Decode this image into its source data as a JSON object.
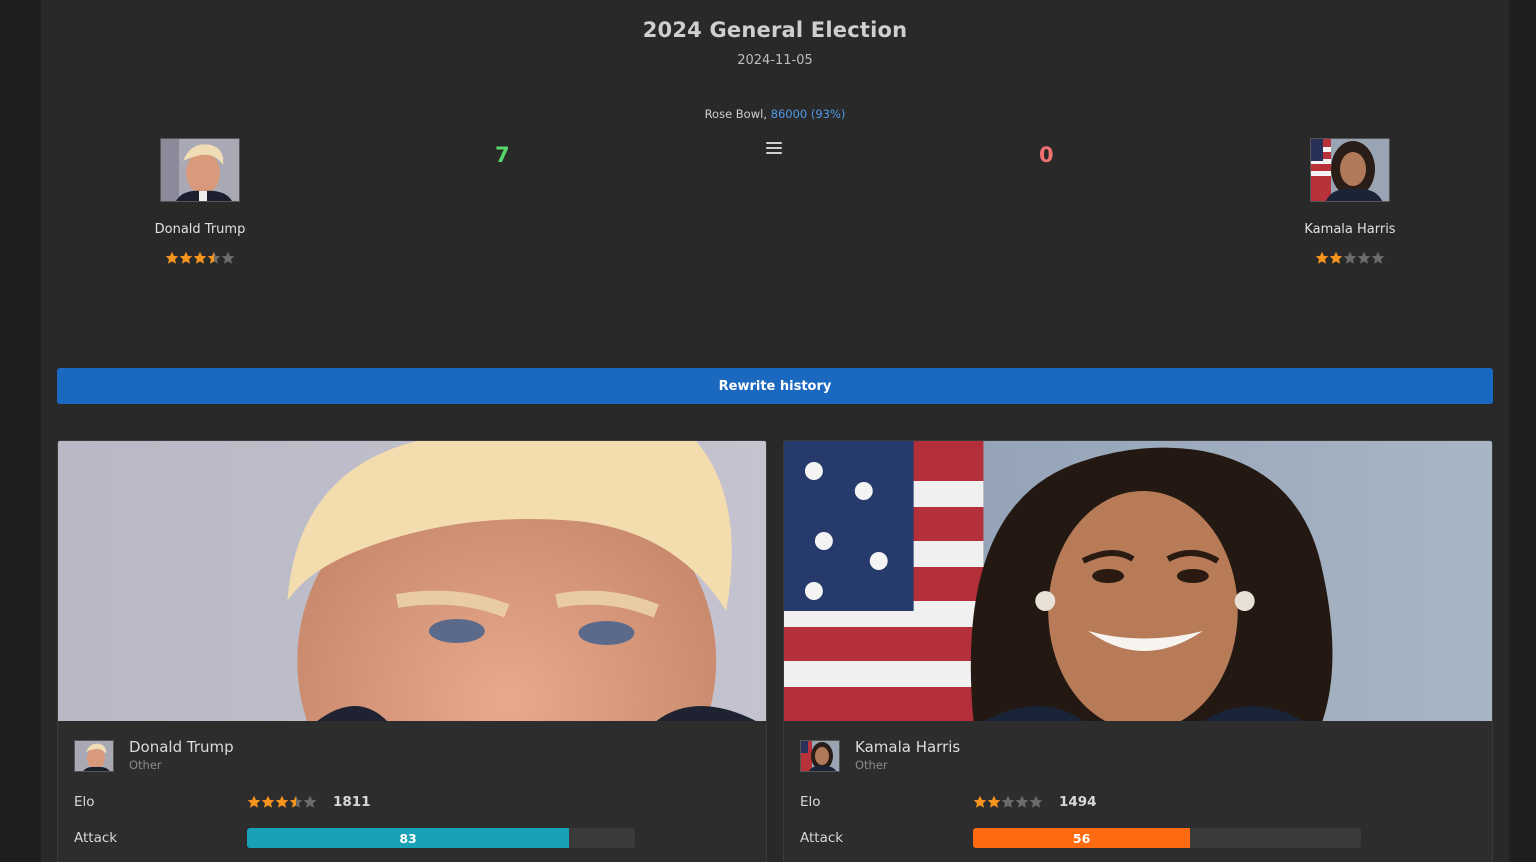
{
  "match": {
    "title": "2024 General Election",
    "date": "2024-11-05",
    "venue": "Rose Bowl",
    "attendance": "86000 (93%)"
  },
  "home": {
    "name": "Donald Trump",
    "league": "Other",
    "score": "7",
    "rating_stars": 3.5,
    "elo": "1811",
    "attack": 83,
    "attack_label": "83",
    "attack_color": "#17a2b8"
  },
  "away": {
    "name": "Kamala Harris",
    "league": "Other",
    "score": "0",
    "rating_stars": 2,
    "elo": "1494",
    "attack": 56,
    "attack_label": "56",
    "attack_color": "#fd6a10"
  },
  "labels": {
    "rewrite": "Rewrite history",
    "elo": "Elo",
    "attack": "Attack"
  },
  "colors": {
    "star_on": "#f7941d",
    "star_off": "#6b6b6b",
    "win_score": "#58d66c",
    "loss_score": "#f07070",
    "button": "#1a68c0"
  },
  "icons": {
    "menu": "hamburger-menu-icon",
    "star": "star-icon"
  }
}
